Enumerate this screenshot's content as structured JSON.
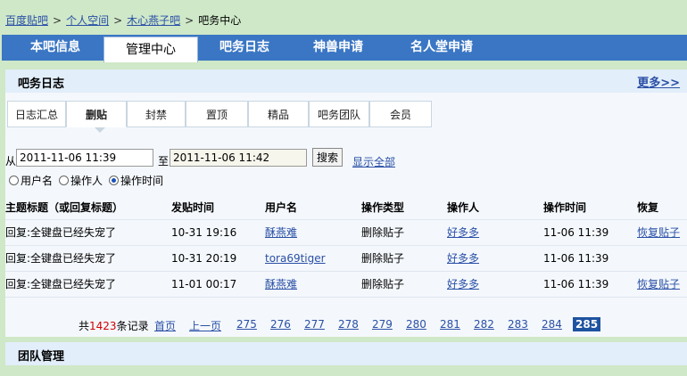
{
  "breadcrumb": [
    "百度贴吧",
    "个人空间",
    "木心燕子吧",
    "吧务中心"
  ],
  "nav": {
    "tabs": [
      "本吧信息",
      "管理中心",
      "吧务日志",
      "神兽申请",
      "名人堂申请"
    ],
    "active": 1
  },
  "panel": {
    "title": "吧务日志",
    "more": "更多>>"
  },
  "subtabs": {
    "items": [
      "日志汇总",
      "删贴",
      "封禁",
      "置顶",
      "精品",
      "吧务团队",
      "会员"
    ],
    "active": 1
  },
  "filter": {
    "from_label": "从",
    "from_value": "2011-11-06 11:39",
    "to_label": "至",
    "to_value": "2011-11-06 11:42",
    "search_button": "搜索",
    "show_all": "显示全部",
    "radios": [
      "用户名",
      "操作人",
      "操作时间"
    ],
    "radio_selected": 2
  },
  "table": {
    "headers": [
      "主题标题（或回复标题）",
      "发贴时间",
      "用户名",
      "操作类型",
      "操作人",
      "操作时间",
      "恢复"
    ],
    "rows": [
      [
        "回复:全键盘已经失宠了",
        "10-31 19:16",
        "酥燕难",
        "删除贴子",
        "好多多",
        "11-06 11:39",
        "恢复贴子"
      ],
      [
        "回复:全键盘已经失宠了",
        "10-31 20:19",
        "tora69tiger",
        "删除贴子",
        "好多多",
        "11-06 11:39",
        ""
      ],
      [
        "回复:全键盘已经失宠了",
        "11-01 00:17",
        "酥燕难",
        "删除贴子",
        "好多多",
        "11-06 11:39",
        "恢复贴子"
      ]
    ]
  },
  "pager": {
    "total_prefix": "共",
    "total_count": "1423",
    "total_suffix": "条记录",
    "first": "首页",
    "prev": "上一页",
    "pages": [
      "275",
      "276",
      "277",
      "278",
      "279",
      "280",
      "281",
      "282",
      "283",
      "284",
      "285"
    ],
    "current": "285"
  },
  "team": {
    "title": "团队管理"
  },
  "colors": {
    "nav_bg": "#3a76c4",
    "page_bg": "#cfe8c8",
    "link": "#2a4fa6",
    "current_page_bg": "#1e53a0",
    "count_red": "#d20000"
  }
}
